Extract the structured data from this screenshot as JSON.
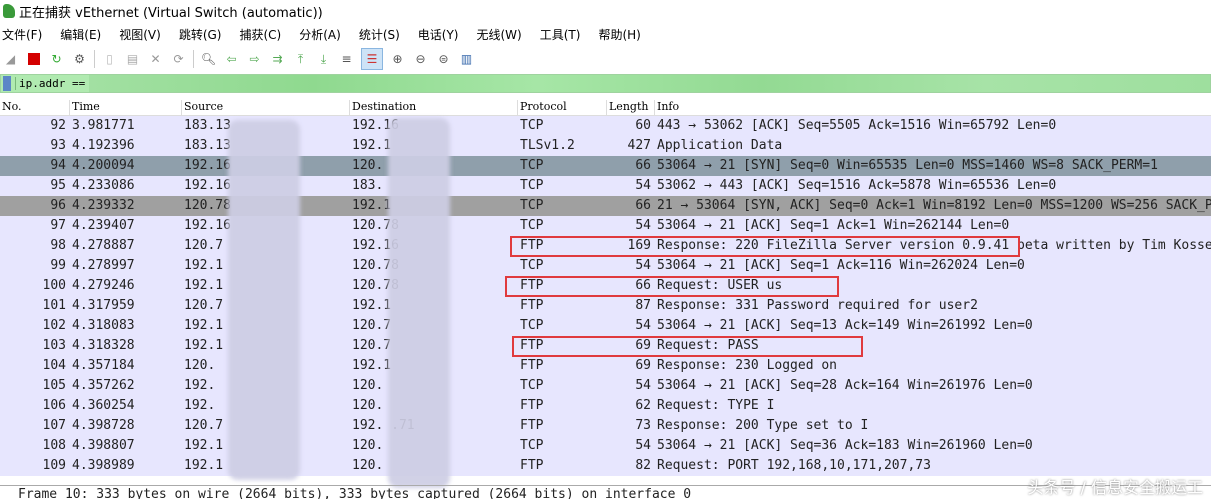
{
  "window": {
    "title": "正在捕获 vEthernet (Virtual Switch (automatic))"
  },
  "menu": [
    "文件(F)",
    "编辑(E)",
    "视图(V)",
    "跳转(G)",
    "捕获(C)",
    "分析(A)",
    "统计(S)",
    "电话(Y)",
    "无线(W)",
    "工具(T)",
    "帮助(H)"
  ],
  "toolbar": {
    "icons": [
      "shark-fin-icon",
      "stop-icon",
      "restart-icon",
      "options-icon",
      "open-icon",
      "save-icon",
      "close-file-icon",
      "reload-icon",
      "find-icon",
      "back-icon",
      "forward-icon",
      "goto-icon",
      "first-icon",
      "last-icon",
      "autoscroll-icon",
      "colorize-icon",
      "zoom-in-icon",
      "zoom-out-icon",
      "zoom-reset-icon",
      "resize-columns-icon"
    ]
  },
  "filter": {
    "value": "ip.addr =="
  },
  "columns": [
    "No.",
    "Time",
    "Source",
    "Destination",
    "Protocol",
    "Length",
    "Info"
  ],
  "packets": [
    {
      "no": "92",
      "time": "3.981771",
      "src": "183.13",
      "dst": "192.16",
      "proto": "TCP",
      "len": "60",
      "info": "443 → 53062 [ACK] Seq=5505 Ack=1516 Win=65792 Len=0",
      "style": "normal"
    },
    {
      "no": "93",
      "time": "4.192396",
      "src": "183.13",
      "dst": "192.1",
      "proto": "TLSv1.2",
      "len": "427",
      "info": "Application Data",
      "style": "normal"
    },
    {
      "no": "94",
      "time": "4.200094",
      "src": "192.16",
      "dst": "120.",
      "proto": "TCP",
      "len": "66",
      "info": "53064 → 21 [SYN] Seq=0 Win=65535 Len=0 MSS=1460 WS=8 SACK_PERM=1",
      "style": "syn"
    },
    {
      "no": "95",
      "time": "4.233086",
      "src": "192.16",
      "dst": "183.",
      "proto": "TCP",
      "len": "54",
      "info": "53062 → 443 [ACK] Seq=1516 Ack=5878 Win=65536 Len=0",
      "style": "normal"
    },
    {
      "no": "96",
      "time": "4.239332",
      "src": "120.78",
      "dst": "192.1",
      "proto": "TCP",
      "len": "66",
      "info": "21 → 53064 [SYN, ACK] Seq=0 Ack=1 Win=8192 Len=0 MSS=1200 WS=256 SACK_PERM=1",
      "style": "synack"
    },
    {
      "no": "97",
      "time": "4.239407",
      "src": "192.16",
      "dst": "120.78",
      "proto": "TCP",
      "len": "54",
      "info": "53064 → 21 [ACK] Seq=1 Ack=1 Win=262144 Len=0",
      "style": "normal"
    },
    {
      "no": "98",
      "time": "4.278887",
      "src": "120.7",
      "dst": "192.16",
      "proto": "FTP",
      "len": "169",
      "info": "Response: 220 FileZilla Server version 0.9.41 beta written by Tim Kosse",
      "style": "normal"
    },
    {
      "no": "99",
      "time": "4.278997",
      "src": "192.1",
      "dst": "120.78",
      "proto": "TCP",
      "len": "54",
      "info": "53064 → 21 [ACK] Seq=1 Ack=116 Win=262024 Len=0",
      "style": "normal"
    },
    {
      "no": "100",
      "time": "4.279246",
      "src": "192.1",
      "dst": "120.78",
      "proto": "FTP",
      "len": "66",
      "info": "Request: USER us",
      "style": "normal"
    },
    {
      "no": "101",
      "time": "4.317959",
      "src": "120.7",
      "dst": "192.1",
      "proto": "FTP",
      "len": "87",
      "info": "Response: 331 Password required for user2",
      "style": "normal"
    },
    {
      "no": "102",
      "time": "4.318083",
      "src": "192.1",
      "dst": "120.7",
      "proto": "TCP",
      "len": "54",
      "info": "53064 → 21 [ACK] Seq=13 Ack=149 Win=261992 Len=0",
      "style": "normal"
    },
    {
      "no": "103",
      "time": "4.318328",
      "src": "192.1",
      "dst": "120.7",
      "proto": "FTP",
      "len": "69",
      "info": "Request: PASS",
      "style": "normal"
    },
    {
      "no": "104",
      "time": "4.357184",
      "src": "120.",
      "dst": "192.1",
      "proto": "FTP",
      "len": "69",
      "info": "Response: 230 Logged on",
      "style": "normal"
    },
    {
      "no": "105",
      "time": "4.357262",
      "src": "192.",
      "dst": "120.",
      "proto": "TCP",
      "len": "54",
      "info": "53064 → 21 [ACK] Seq=28 Ack=164 Win=261976 Len=0",
      "style": "normal"
    },
    {
      "no": "106",
      "time": "4.360254",
      "src": "192.",
      "dst": "120.",
      "proto": "FTP",
      "len": "62",
      "info": "Request: TYPE I",
      "style": "normal"
    },
    {
      "no": "107",
      "time": "4.398728",
      "src": "120.7",
      "dst": "192.      .71",
      "proto": "FTP",
      "len": "73",
      "info": "Response: 200 Type set to I",
      "style": "normal"
    },
    {
      "no": "108",
      "time": "4.398807",
      "src": "192.1",
      "dst": "120.",
      "proto": "TCP",
      "len": "54",
      "info": "53064 → 21 [ACK] Seq=36 Ack=183 Win=261960 Len=0",
      "style": "normal"
    },
    {
      "no": "109",
      "time": "4.398989",
      "src": "192.1",
      "dst": "120.",
      "proto": "FTP",
      "len": "82",
      "info": "Request: PORT 192,168,10,171,207,73",
      "style": "normal"
    }
  ],
  "details": {
    "frame": "Frame 10: 333 bytes on wire (2664 bits), 333 bytes captured (2664 bits) on interface 0"
  },
  "watermark": "头条号 / 信息安全搬运工",
  "colors": {
    "row": "#e7e6fe",
    "syn": "#8f9fab",
    "synack": "#a0a0a0",
    "filter": "#b0eab0",
    "highlight": "#e03a3e"
  }
}
